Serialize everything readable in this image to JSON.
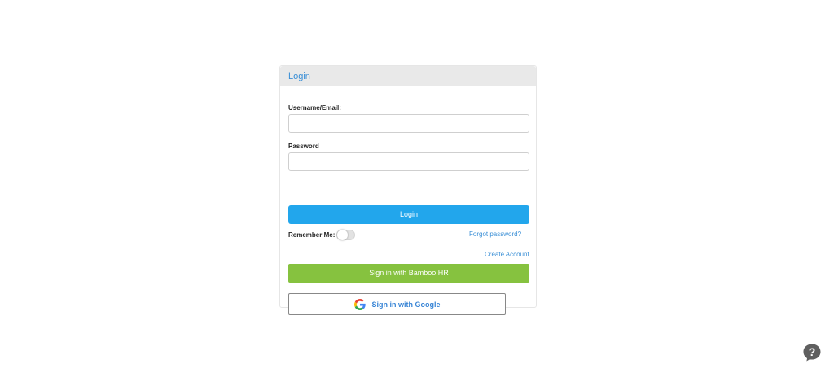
{
  "login": {
    "title": "Login",
    "username_label": "Username/Email:",
    "username_value": "",
    "password_label": "Password",
    "password_value": "",
    "login_button": "Login",
    "remember_label": "Remember Me:",
    "remember_checked": false,
    "forgot_password": "Forgot password?",
    "create_account": "Create Account",
    "bamboo_button": "Sign in with Bamboo HR",
    "google_button": "Sign in with Google"
  },
  "help": {
    "icon": "help-question-icon"
  },
  "colors": {
    "primary_blue": "#22a6ec",
    "link_blue": "#3a8fd6",
    "bamboo_green": "#86c23f",
    "header_bg": "#e9e9e9"
  }
}
